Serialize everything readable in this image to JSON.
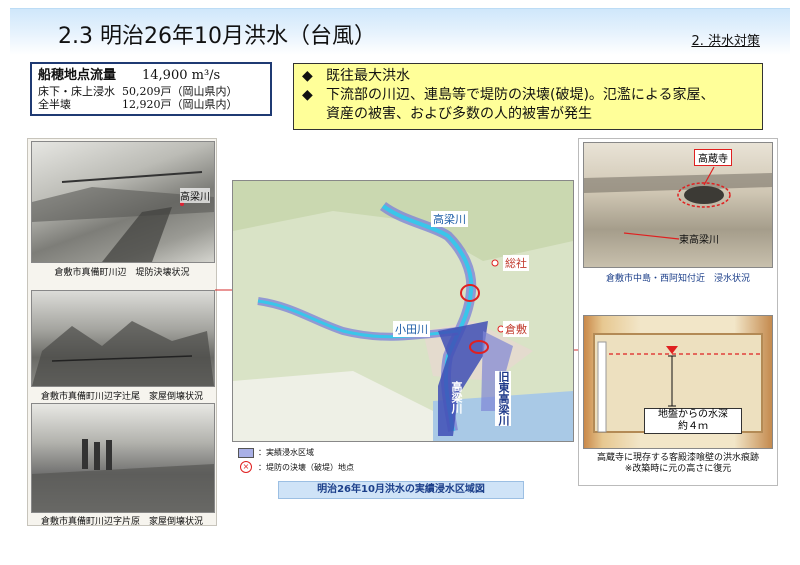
{
  "header": {
    "title": "2.3 明治26年10月洪水（台風）",
    "section": "2. 洪水対策"
  },
  "stats": {
    "flow_label": "船穂地点流量",
    "flow_value": "14,900 m³/s",
    "flood_label": "床下・床上浸水",
    "flood_value": "50,209戸（岡山県内）",
    "collapse_label": "全半壊",
    "collapse_value": "12,920戸（岡山県内）"
  },
  "notes": {
    "bullet_glyph": "◆",
    "line1": "既往最大洪水",
    "line2": "下流部の川辺、連島等で堤防の決壊(破堤)。氾濫による家屋、",
    "line2_cont": "資産の被害、および多数の人的被害が発生"
  },
  "left_photos": {
    "photo1_label": "高梁川",
    "photo1_caption": "倉敷市真備町川辺　堤防決壊状況",
    "photo2_caption": "倉敷市真備町川辺字辻尾　家屋倒壊状況",
    "photo3_caption": "倉敷市真備町川辺字片原　家屋倒壊状況"
  },
  "map": {
    "label_takahashi": "高梁川",
    "label_soja": "総社",
    "label_odagawa": "小田川",
    "label_kurashiki": "倉敷",
    "label_takahashi_vert": "高梁川",
    "label_old_east": "旧東高梁川",
    "legend_area": "：実績浸水区域",
    "legend_break": "：堤防の決壊（破堤）地点",
    "caption": "明治26年10月洪水の実績浸水区域図"
  },
  "right_photos": {
    "temple_label": "高蔵寺",
    "river_label": "東高梁川",
    "photo1_caption": "倉敷市中島・西阿知付近　浸水状況",
    "depth_label_line1": "地盤からの水深",
    "depth_label_line2": "約４ｍ",
    "photo2_caption_line1": "高蔵寺に現存する客殿漆喰壁の洪水痕跡",
    "photo2_caption_line2": "※改築時に元の高さに復元"
  },
  "colors": {
    "header_gradient_top": "#cfe7fb",
    "stats_border": "#1f3a73",
    "notes_bg": "#ffff99",
    "flood_area": "#7f86d6",
    "river": "#39c6ea",
    "break_point": "#e02020",
    "caption_blue": "#1c3f8a"
  },
  "icons": [
    "bullet-diamond-icon",
    "break-point-icon",
    "water-level-marker-icon"
  ]
}
